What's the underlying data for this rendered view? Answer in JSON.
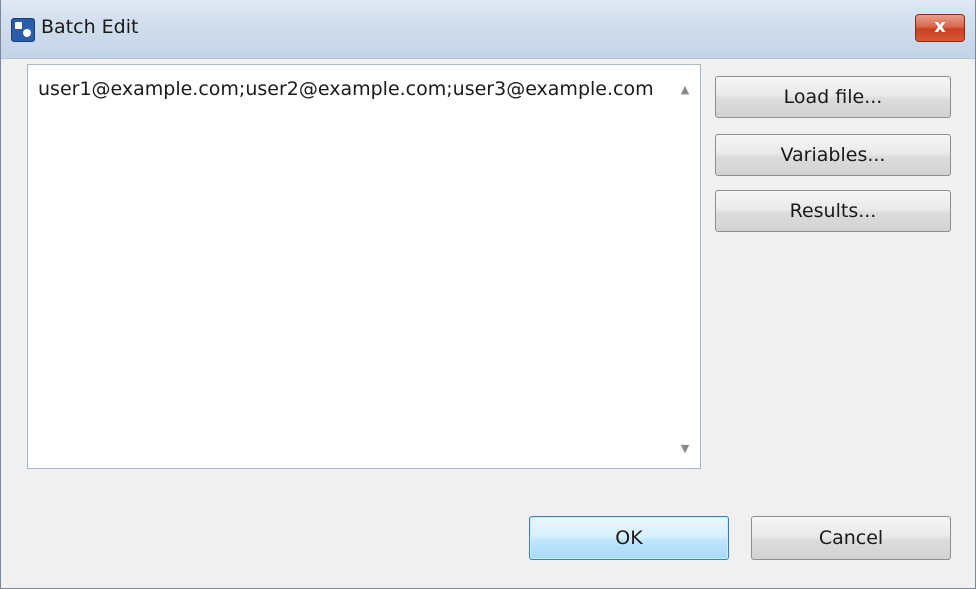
{
  "window": {
    "title": "Batch Edit",
    "close_label": "x"
  },
  "editor": {
    "value": "user1@example.com;user2@example.com;user3@example.com",
    "scroll_up_icon": "▲",
    "scroll_down_icon": "▼"
  },
  "side_buttons": {
    "load_file": "Load file...",
    "variables": "Variables...",
    "results": "Results..."
  },
  "dialog_buttons": {
    "ok": "OK",
    "cancel": "Cancel"
  },
  "colors": {
    "titlebar": "#cfdcec",
    "close_button": "#c8401e",
    "default_button_border": "#3c7fb1"
  }
}
